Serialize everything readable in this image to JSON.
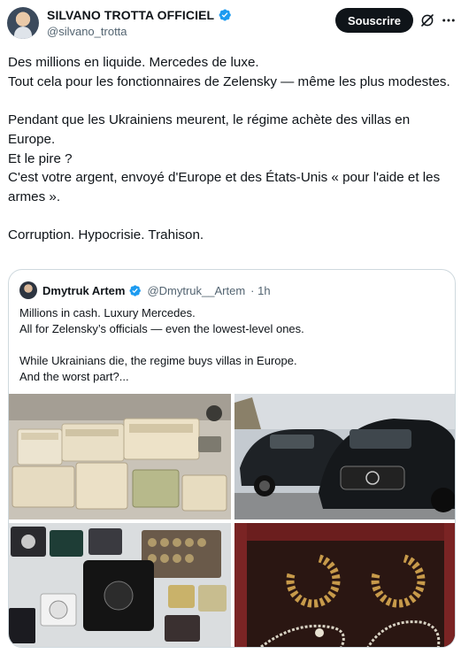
{
  "author": {
    "display_name": "SILVANO TROTTA OFFICIEL",
    "handle": "@silvano_trotta",
    "verified_icon": "verified-badge-icon"
  },
  "actions": {
    "subscribe_label": "Souscrire",
    "grok_icon": "grok-icon",
    "more_icon": "more-options-icon"
  },
  "post": {
    "lines": [
      "Des millions en liquide. Mercedes de luxe.",
      "Tout cela pour les fonctionnaires de Zelensky — même les plus modestes.",
      "Pendant que les Ukrainiens meurent, le régime achète des villas en Europe.",
      "Et le pire ?",
      "C'est votre argent, envoyé d'Europe et des États-Unis « pour l'aide et les armes ».",
      "Corruption. Hypocrisie. Trahison."
    ]
  },
  "quoted": {
    "display_name": "Dmytruk Artem",
    "handle": "@Dmytruk__Artem",
    "time": "· 1h",
    "lines": [
      "Millions in cash. Luxury Mercedes.",
      "All for Zelensky’s officials — even the lowest-level ones.",
      "While Ukrainians die, the regime buys villas in Europe.",
      "And the worst part?..."
    ]
  },
  "colors": {
    "text": "#0f1419",
    "secondary": "#536471",
    "verified": "#1d9bf0",
    "border": "#cfd9de",
    "button_bg": "#0f1419"
  }
}
